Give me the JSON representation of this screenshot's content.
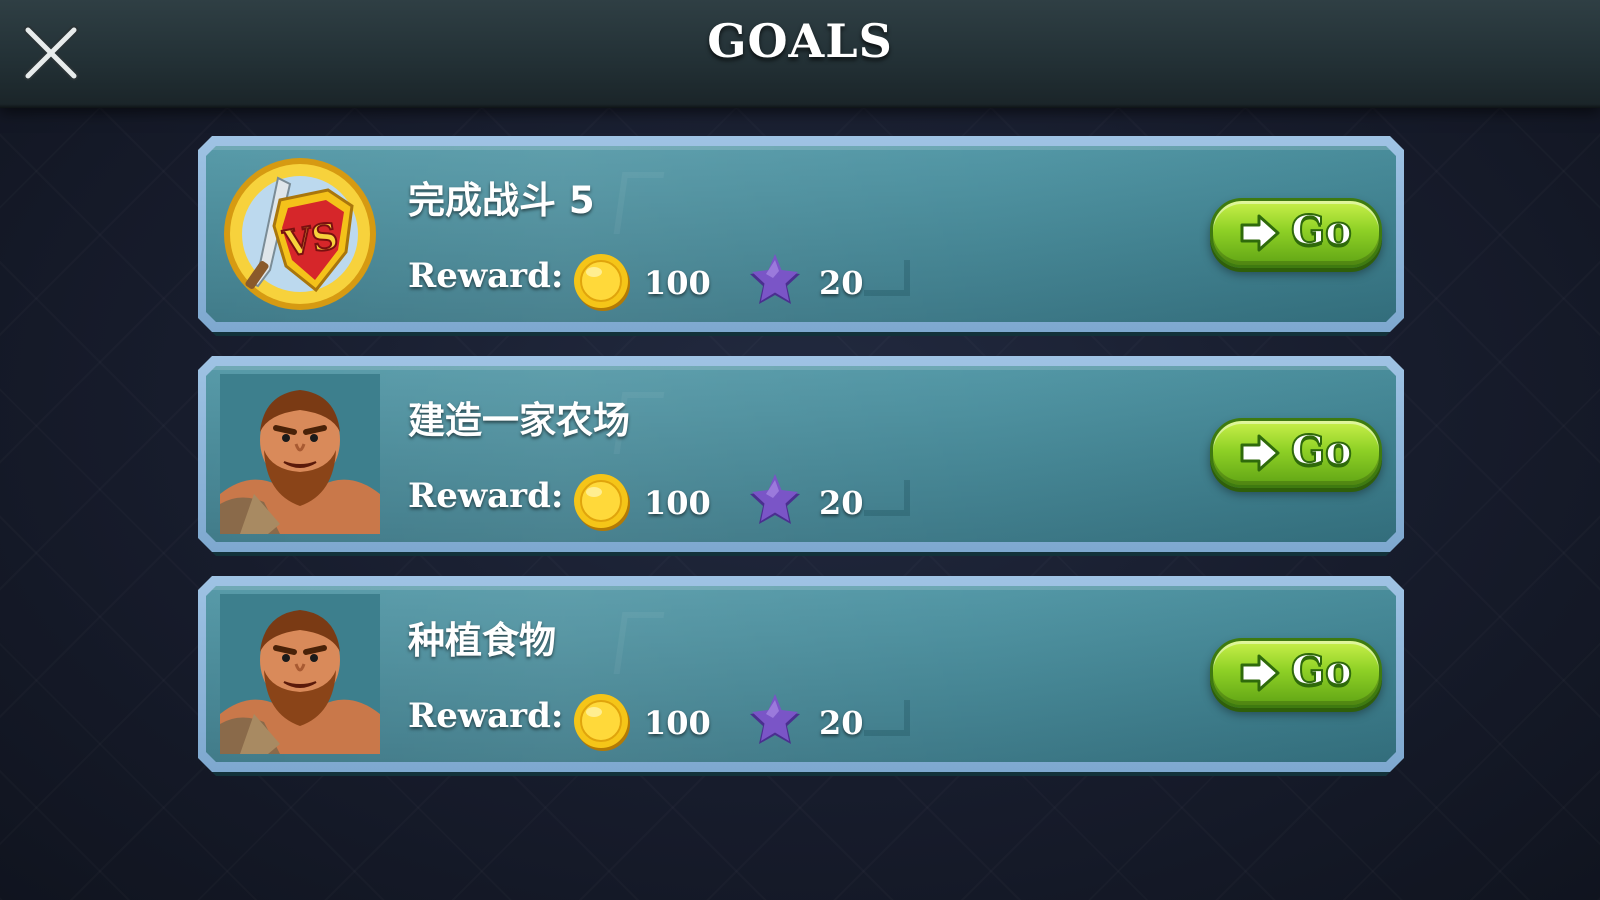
{
  "header": {
    "title": "GOALS",
    "close_icon": "close-x-icon"
  },
  "reward_label": "Reward:",
  "colors": {
    "card": "#3f8291",
    "card_border": "#8fb5da",
    "go_button": "#8fd126",
    "coin": "#f5c518",
    "star": "#6b4ab8"
  },
  "goals": [
    {
      "title": "完成战斗 5",
      "avatar_icon": "battle-vs-shield-icon",
      "reward_label": "Reward:",
      "coins": "100",
      "stars": "20",
      "go_label": "Go"
    },
    {
      "title": "建造一家农场",
      "avatar_icon": "caveman-avatar-icon",
      "reward_label": "Reward:",
      "coins": "100",
      "stars": "20",
      "go_label": "Go"
    },
    {
      "title": "种植食物",
      "avatar_icon": "caveman-avatar-icon",
      "reward_label": "Reward:",
      "coins": "100",
      "stars": "20",
      "go_label": "Go"
    }
  ]
}
